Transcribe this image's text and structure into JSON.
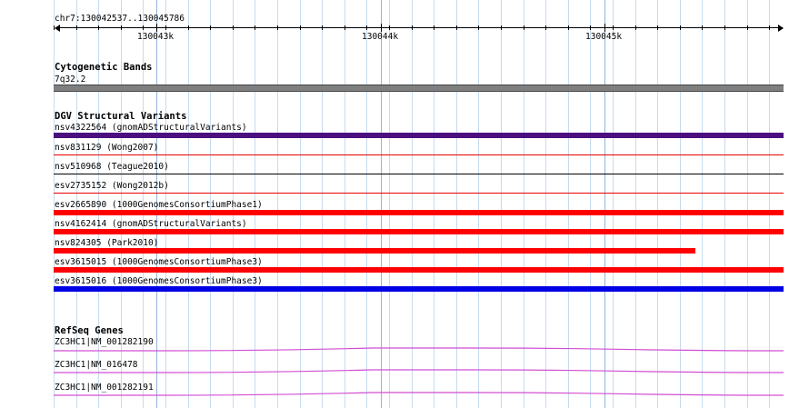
{
  "ruler": {
    "locus": "chr7:130042537..130045786",
    "ticks": [
      "130043k",
      "130044k",
      "130045k"
    ]
  },
  "tracks": {
    "cytoband": {
      "title": "Cytogenetic Bands",
      "band": "7q32.2",
      "color": "#7f7f7f"
    },
    "dgv": {
      "title": "DGV Structural Variants",
      "variants": [
        {
          "label": "nsv4322564 (gnomADStructuralVariants)",
          "color": "#4b0f7f",
          "style": "thick"
        },
        {
          "label": "nsv831129 (Wong2007)",
          "color": "#e60000",
          "style": "thin"
        },
        {
          "label": "nsv510968 (Teague2010)",
          "color": "#000000",
          "style": "thin"
        },
        {
          "label": "esv2735152 (Wong2012b)",
          "color": "#e60000",
          "style": "thin"
        },
        {
          "label": "esv2665890 (1000GenomesConsortiumPhase1)",
          "color": "#ff0000",
          "style": "thick"
        },
        {
          "label": "nsv4162414 (gnomADStructuralVariants)",
          "color": "#ff0000",
          "style": "thick"
        },
        {
          "label": "nsv824305 (Park2010)",
          "color": "#ff0000",
          "style": "thick-partial"
        },
        {
          "label": "esv3615015 (1000GenomesConsortiumPhase3)",
          "color": "#ff0000",
          "style": "thick"
        },
        {
          "label": "esv3615016 (1000GenomesConsortiumPhase3)",
          "color": "#0000e6",
          "style": "thick"
        }
      ]
    },
    "refseq": {
      "title": "RefSeq Genes",
      "color": "#d24dd2",
      "genes": [
        {
          "label": "ZC3HC1|NM_001282190"
        },
        {
          "label": "ZC3HC1|NM_016478"
        },
        {
          "label": "ZC3HC1|NM_001282191"
        }
      ]
    }
  }
}
